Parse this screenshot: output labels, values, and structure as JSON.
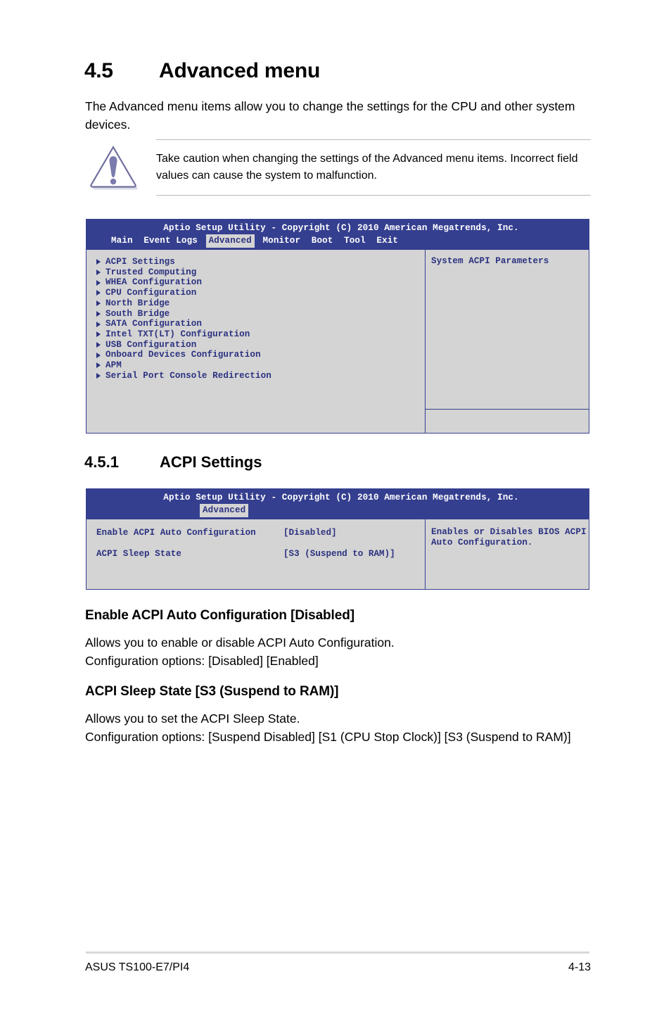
{
  "section": {
    "number": "4.5",
    "title": "Advanced menu",
    "intro": "The Advanced menu items allow you to change the settings for the CPU and other system devices."
  },
  "caution": {
    "icon": "warning-triangle-icon",
    "text": "Take caution when changing the settings of the Advanced menu items. Incorrect field values can cause the system to malfunction."
  },
  "bios_advanced": {
    "title": "Aptio Setup Utility - Copyright (C) 2010 American Megatrends, Inc.",
    "tabs": [
      {
        "label": "Main",
        "selected": false
      },
      {
        "label": "Event Logs",
        "selected": false
      },
      {
        "label": "Advanced",
        "selected": true
      },
      {
        "label": "Monitor",
        "selected": false
      },
      {
        "label": "Boot",
        "selected": false
      },
      {
        "label": "Tool",
        "selected": false
      },
      {
        "label": "Exit",
        "selected": false
      }
    ],
    "items": [
      "ACPI Settings",
      "Trusted Computing",
      "WHEA Configuration",
      "CPU Configuration",
      "North Bridge",
      "South Bridge",
      "SATA Configuration",
      "Intel TXT(LT) Configuration",
      "USB Configuration",
      "Onboard Devices Configuration",
      "APM",
      "Serial Port Console Redirection"
    ],
    "help": "System ACPI Parameters"
  },
  "subsection": {
    "number": "4.5.1",
    "title": "ACPI Settings"
  },
  "bios_acpi": {
    "title": "Aptio Setup Utility - Copyright (C) 2010 American Megatrends, Inc.",
    "tabs": [
      {
        "label": "Advanced",
        "selected": true
      }
    ],
    "fields": [
      {
        "name": "Enable ACPI Auto Configuration",
        "value": "[Disabled]"
      },
      {
        "name": "ACPI Sleep State",
        "value": "[S3 (Suspend to RAM)]"
      }
    ],
    "help_line1": "Enables or Disables BIOS ACPI",
    "help_line2": "Auto Configuration."
  },
  "items": [
    {
      "heading": "Enable ACPI Auto Configuration [Disabled]",
      "body": "Allows you to enable or disable ACPI Auto Configuration.\nConfiguration options: [Disabled] [Enabled]"
    },
    {
      "heading": "ACPI Sleep State [S3 (Suspend to RAM)]",
      "body": "Allows you to set the ACPI Sleep State.\nConfiguration options: [Suspend Disabled] [S1 (CPU Stop Clock)] [S3 (Suspend to RAM)]"
    }
  ],
  "footer": {
    "left": "ASUS TS100-E7/PI4",
    "right": "4-13"
  },
  "colors": {
    "bios_header_blue": "#353f8f",
    "bios_text_blue": "#2c3280",
    "bios_panel_gray": "#d4d4d4",
    "note_icon_purple": "#7b7bad"
  }
}
